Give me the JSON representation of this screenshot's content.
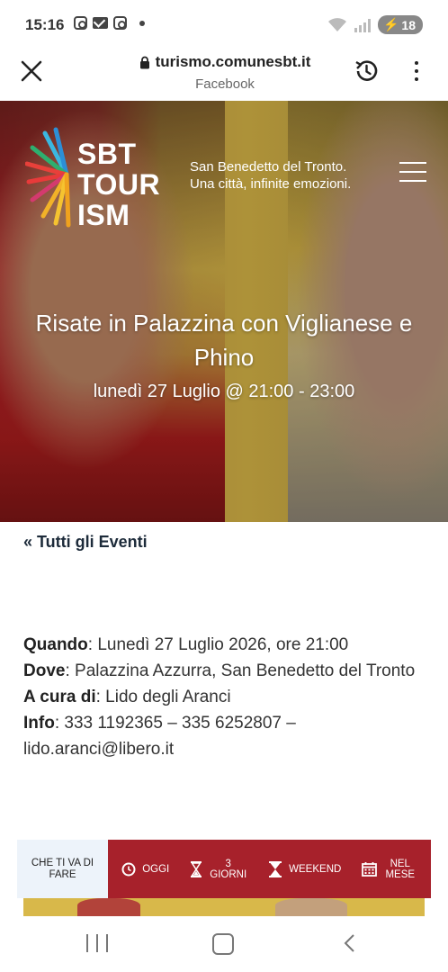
{
  "status_bar": {
    "time": "15:16",
    "battery": "18",
    "notification_icons": [
      "instagram-icon",
      "mail-icon",
      "instagram-icon",
      "dot-icon"
    ]
  },
  "browser": {
    "url": "turismo.comunesbt.it",
    "source": "Facebook",
    "icons": [
      "close-icon",
      "lock-icon",
      "history-icon",
      "more-icon"
    ]
  },
  "site": {
    "logo_lines": [
      "SBT",
      "TOUR",
      "ISM"
    ],
    "tagline_1": "San Benedetto del Tronto.",
    "tagline_2": "Una città, infinite emozioni.",
    "menu_icon": "hamburger-icon"
  },
  "event": {
    "title": "Risate in Palazzina con Viglianese e Phino",
    "datetime": "lunedì 27 Luglio @ 21:00 - 23:00"
  },
  "back_link": "« Tutti gli Eventi",
  "details": {
    "when_label": "Quando",
    "when_value": ": Lunedì 27 Luglio 2026, ore 21:00",
    "where_label": "Dove",
    "where_value": ": Palazzina Azzurra, San Benedetto del Tronto",
    "curator_label": "A cura di",
    "curator_value": ": Lido degli Aranci",
    "info_label": "Info",
    "info_value": ": 333 1192365 – 335 6252807 – lido.aranci@libero.it"
  },
  "filter_bar": {
    "title": "CHE TI VA DI FARE",
    "today": "OGGI",
    "three_days": "3 GIORNI",
    "weekend": "WEEKEND",
    "month": "NEL MESE"
  },
  "colors": {
    "bar_red": "#a7212b",
    "bar_light": "#edf3fa",
    "hero_yellow": "#d4b246"
  }
}
